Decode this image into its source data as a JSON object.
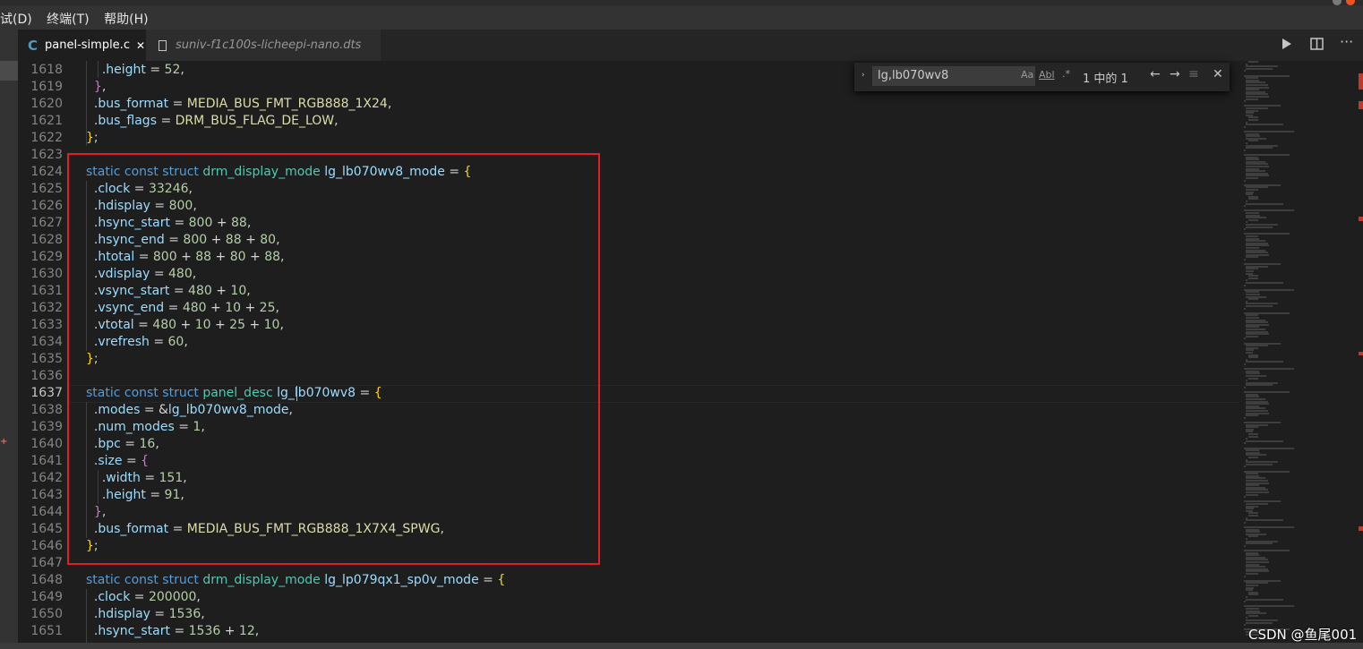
{
  "menu": {
    "items": [
      "试(D)",
      "终端(T)",
      "帮助(H)"
    ]
  },
  "tabs": [
    {
      "label": "panel-simple.c",
      "icon": "c-file-icon",
      "close": "✕"
    },
    {
      "label": "suniv-f1c100s-licheepi-nano.dts",
      "icon": "file-icon"
    }
  ],
  "editor_actions": [
    "run-icon",
    "split-editor-icon",
    "more-actions-icon"
  ],
  "find_widget": {
    "toggle": "›",
    "query": "lg,lb070wv8",
    "match_case": "Aa",
    "whole_word": "Abl",
    "regex": ".*",
    "result": "1 中的 1",
    "prev": "←",
    "next": "→",
    "selection": "≡",
    "close": "✕"
  },
  "activity_badge": "+",
  "code": {
    "line_numbers": [
      "1618",
      "1619",
      "1620",
      "1621",
      "1622",
      "1623",
      "1624",
      "1625",
      "1626",
      "1627",
      "1628",
      "1629",
      "1630",
      "1631",
      "1632",
      "1633",
      "1634",
      "1635",
      "1636",
      "1637",
      "1638",
      "1639",
      "1640",
      "1641",
      "1642",
      "1643",
      "1644",
      "1645",
      "1646",
      "1647",
      "1648",
      "1649",
      "1650",
      "1651"
    ],
    "current_line": "1637",
    "lines": [
      "    .height = 52,",
      "  },",
      "  .bus_format = MEDIA_BUS_FMT_RGB888_1X24,",
      "  .bus_flags = DRM_BUS_FLAG_DE_LOW,",
      "};",
      "",
      "static const struct drm_display_mode lg_lb070wv8_mode = {",
      "  .clock = 33246,",
      "  .hdisplay = 800,",
      "  .hsync_start = 800 + 88,",
      "  .hsync_end = 800 + 88 + 80,",
      "  .htotal = 800 + 88 + 80 + 88,",
      "  .vdisplay = 480,",
      "  .vsync_start = 480 + 10,",
      "  .vsync_end = 480 + 10 + 25,",
      "  .vtotal = 480 + 10 + 25 + 10,",
      "  .vrefresh = 60,",
      "};",
      "",
      "static const struct panel_desc lg_lb070wv8 = {",
      "  .modes = &lg_lb070wv8_mode,",
      "  .num_modes = 1,",
      "  .bpc = 16,",
      "  .size = {",
      "    .width = 151,",
      "    .height = 91,",
      "  },",
      "  .bus_format = MEDIA_BUS_FMT_RGB888_1X7X4_SPWG,",
      "};",
      "",
      "static const struct drm_display_mode lg_lp079qx1_sp0v_mode = {",
      "  .clock = 200000,",
      "  .hdisplay = 1536,",
      "  .hsync_start = 1536 + 12,"
    ]
  },
  "watermark": "CSDN @鱼尾001",
  "colors": {
    "keyword": "#569cd6",
    "type": "#4ec9b0",
    "identifier": "#9cdcfe",
    "number": "#b5cea8",
    "macro": "#dcdcaa",
    "highlight_box": "#e02020",
    "background": "#1e1e1e"
  }
}
